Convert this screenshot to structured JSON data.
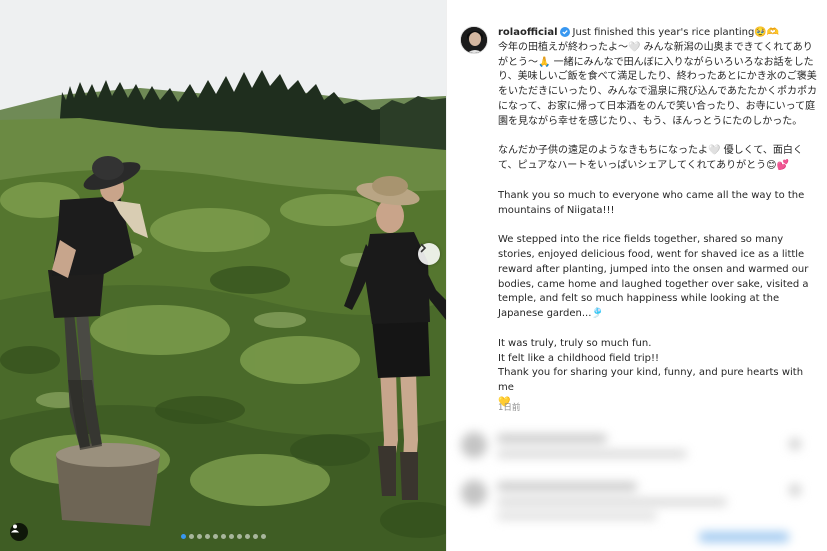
{
  "post": {
    "username": "rolaofficial",
    "title_line": "Just finished this year's rice planting🥹🫶",
    "japanese_paragraph_1": "今年の田植えが終わったよ〜🤍 みんな新潟の山奥まできてくれてありがとう〜🙏 一緒にみんなで田んぼに入りながらいろいろなお話をしたり、美味しいご飯を食べて満足したり、終わったあとにかき氷のご褒美をいただきにいったり、みんなで温泉に飛び込んであたたかくポカポカになって、お家に帰って日本酒をのんで笑い合ったり、お寺にいって庭園を見ながら幸せを感じたり、、もう、ほんっとうにたのしかった。",
    "japanese_paragraph_2": "なんだか子供の遠足のようなきもちになったよ🤍 優しくて、面白くて、ピュアなハートをいっぱいシェアしてくれてありがとう😊💕",
    "english_paragraph_1": "Thank you so much to everyone who came all the way to the mountains of Niigata!!!",
    "english_paragraph_2": "We stepped into the rice fields together, shared so many stories, enjoyed delicious food, went for shaved ice as a little reward after planting, jumped into the onsen and warmed our bodies, came home and laughed together over sake, visited a temple, and felt so much happiness while looking at the Japanese garden...🎐",
    "english_closing_1": "It was truly, truly so much fun.",
    "english_closing_2": "It felt like a childhood field trip!!",
    "english_closing_3": "Thank you for sharing your kind, funny, and pure hearts with me",
    "english_closing_4": "💛",
    "timestamp": "1日前"
  },
  "photo": {
    "active_slide": 1,
    "slide_count": 11
  },
  "icons": {
    "verified": "verified-badge-icon",
    "next": "chevron-right-icon",
    "tag": "user-tag-icon"
  },
  "colors": {
    "verified_blue": "#3897f0",
    "text": "#262626",
    "muted": "#8e8e8e"
  }
}
